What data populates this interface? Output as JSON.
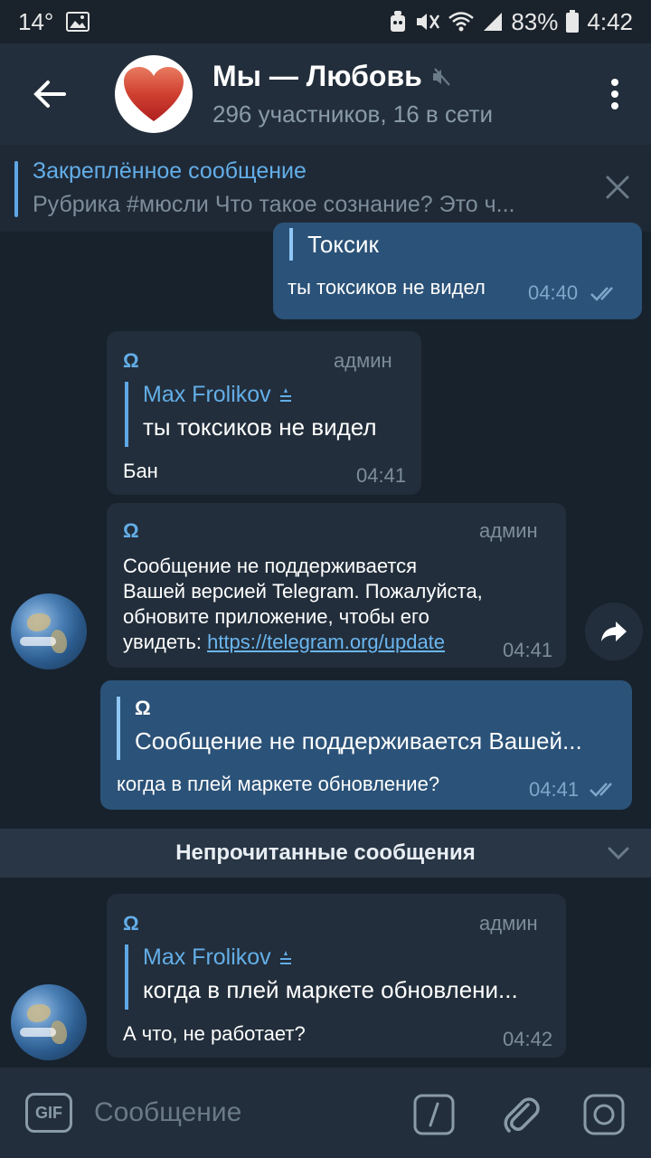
{
  "status_bar": {
    "temperature": "14°",
    "battery": "83%",
    "time": "4:42"
  },
  "header": {
    "title": "Мы — Любовь",
    "subtitle": "296 участников, 16 в сети"
  },
  "pinned": {
    "title": "Закреплённое сообщение",
    "preview": "Рубрика #мюсли  Что такое сознание? Это ч..."
  },
  "messages": [
    {
      "type": "outgoing",
      "reply_text": "Токсик",
      "text": "ты токсиков не видел",
      "time": "04:40"
    },
    {
      "type": "incoming",
      "sender": "Ω",
      "role": "админ",
      "reply_name": "Max Frolikov",
      "reply_text": "ты токсиков не видел",
      "text": "Бан",
      "time": "04:41"
    },
    {
      "type": "incoming",
      "sender": "Ω",
      "role": "админ",
      "text_line1": "Сообщение не поддерживается",
      "text_line2": "Вашей версией Telegram. Пожалуйста,",
      "text_line3": "обновите приложение, чтобы его",
      "text_line4_prefix": "увидеть: ",
      "link": "https://telegram.org/update",
      "time": "04:41"
    },
    {
      "type": "outgoing",
      "reply_name": "Ω",
      "reply_text": "Сообщение не поддерживается Вашей...",
      "text": "когда в плей маркете обновление?",
      "time": "04:41"
    },
    {
      "type": "incoming",
      "sender": "Ω",
      "role": "админ",
      "reply_name": "Max Frolikov",
      "reply_text": "когда в плей маркете обновлени...",
      "text": "А что, не работает?",
      "time": "04:42"
    }
  ],
  "unread_divider": "Непрочитанные сообщения",
  "input": {
    "gif_label": "GIF",
    "placeholder": "Сообщение"
  },
  "colors": {
    "accent": "#63aee8",
    "outgoing_bubble": "#2b5278",
    "incoming_bubble": "#222e3b",
    "background": "#18222d"
  }
}
